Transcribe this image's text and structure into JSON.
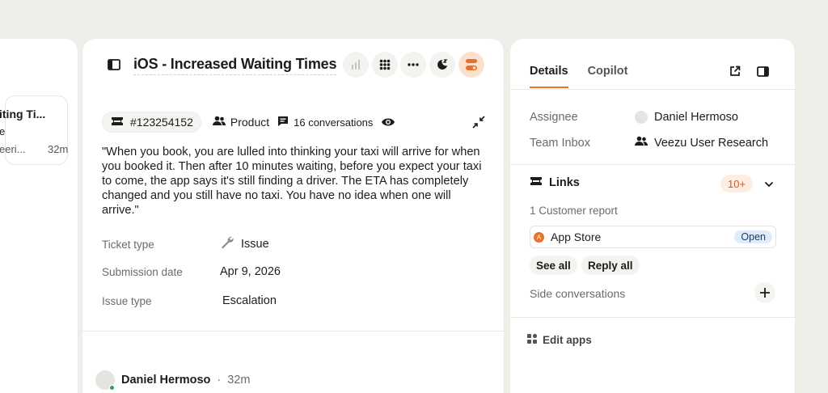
{
  "left_card": {
    "title": "iting Ti...",
    "line2": "e",
    "line3": "eeri...",
    "time": "32m"
  },
  "ticket": {
    "title": "iOS - Increased Waiting Times",
    "id": "#123254152",
    "team": "Product",
    "conversations": "16 conversations",
    "quote": "\"When you book, you are lulled into thinking your taxi will arrive for when you booked it. Then after 10 minutes waiting, before you expect your taxi to come, the app says it's still finding a driver. The ETA has completely changed and you still have no taxi. You have no idea when one will arrive.\"",
    "props": {
      "ticket_type_label": "Ticket type",
      "ticket_type_value": "Issue",
      "submission_label": "Submission date",
      "submission_value": "Apr 9, 2026",
      "issue_type_label": "Issue type",
      "issue_type_value": "Escalation"
    },
    "author": "Daniel Hermoso",
    "separator": "·",
    "author_time": "32m"
  },
  "header_icons": [
    "sidebar-toggle-icon",
    "bar-chart-icon",
    "grid-icon",
    "more-icon",
    "snooze-icon",
    "toggle-icon"
  ],
  "details": {
    "tabs": [
      "Details",
      "Copilot"
    ],
    "assignee_label": "Assignee",
    "assignee_value": "Daniel Hermoso",
    "inbox_label": "Team Inbox",
    "inbox_value": "Veezu User Research",
    "links_label": "Links",
    "links_count": "10+",
    "customer_report": "1 Customer report",
    "report_name": "App Store",
    "report_icon_letter": "A",
    "report_status": "Open",
    "see_all": "See all",
    "reply_all": "Reply all",
    "side_conversations": "Side conversations",
    "edit_apps": "Edit apps"
  },
  "colors": {
    "accent": "#e8722c",
    "accent_soft": "#fde1cf",
    "background": "#efefea",
    "open_badge": "#deebfa"
  }
}
